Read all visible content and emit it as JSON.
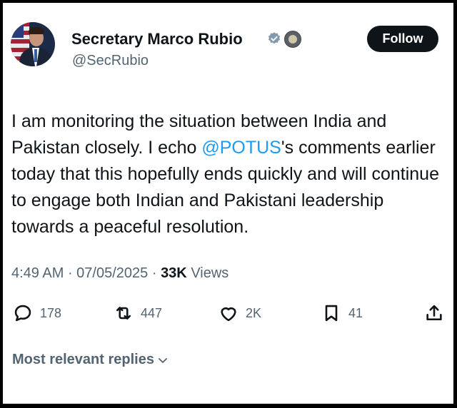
{
  "profile": {
    "display_name": "Secretary Marco Rubio",
    "handle": "@SecRubio",
    "verified_icon": "gray-verified-badge-icon",
    "affiliation_icon": "government-seal-icon"
  },
  "follow_button": {
    "label": "Follow"
  },
  "tweet": {
    "text_part1": "I am monitoring the situation between India and Pakistan closely. I echo ",
    "mention": "@POTUS",
    "text_part2": "'s comments earlier today that this hopefully ends quickly and will continue to engage both Indian and Pakistani leadership towards a peaceful resolution."
  },
  "meta": {
    "time": "4:49 AM",
    "separator": " · ",
    "date": "07/05/2025",
    "views_count": "33K",
    "views_label": " Views"
  },
  "actions": {
    "replies": "178",
    "reposts": "447",
    "likes": "2K",
    "bookmarks": "41"
  },
  "replies_sort": {
    "label": "Most relevant replies"
  },
  "colors": {
    "text": "#0f1419",
    "secondary": "#536471",
    "link": "#1d9bf0",
    "follow_bg": "#0f1419",
    "verified_gray": "#829aab"
  }
}
